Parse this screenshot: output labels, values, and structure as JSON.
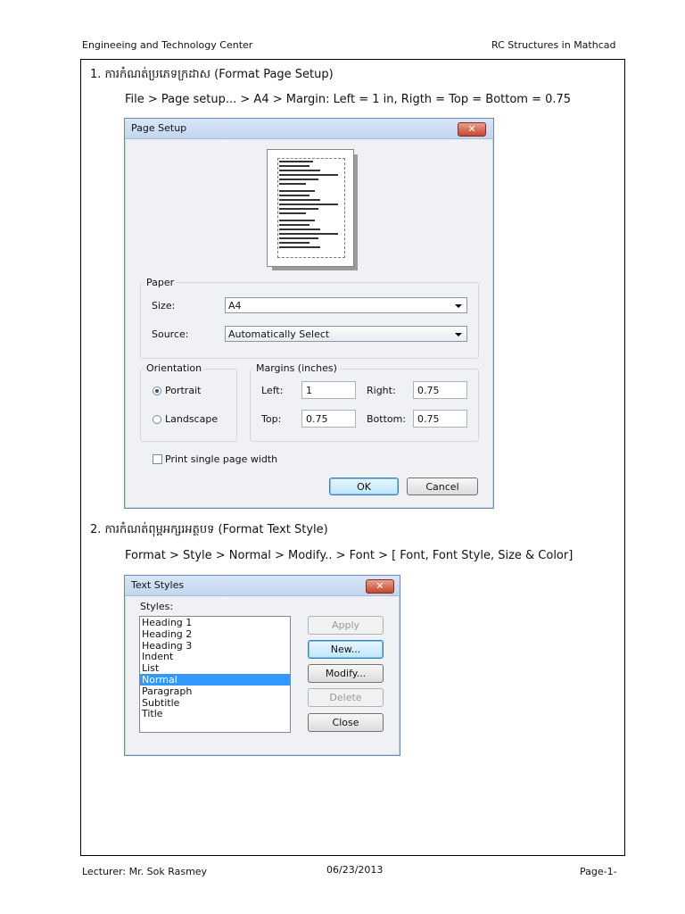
{
  "header": {
    "left": "Engineeing and Technology Center",
    "right": "RC Structures in Mathcad"
  },
  "section1": {
    "heading": "1. ការកំណត់ប្រភេទក្រដាស (Format Page Setup)",
    "path": "File > Page setup... > A4 > Margin: Left = 1 in,  Rigth = Top = Bottom = 0.75"
  },
  "page_setup": {
    "title": "Page Setup",
    "close": "✕",
    "paper_group": "Paper",
    "size_label": "Size:",
    "size_value": "A4",
    "source_label": "Source:",
    "source_value": "Automatically Select",
    "orientation_group": "Orientation",
    "portrait": "Portrait",
    "landscape": "Landscape",
    "margins_group": "Margins (inches)",
    "left_label": "Left:",
    "left_value": "1",
    "right_label": "Right:",
    "right_value": "0.75",
    "top_label": "Top:",
    "top_value": "0.75",
    "bottom_label": "Bottom:",
    "bottom_value": "0.75",
    "print_single": "Print single page width",
    "ok": "OK",
    "cancel": "Cancel"
  },
  "section2": {
    "heading": "2. ការកំណត់ពុម្ពអក្សរអត្ថបទ (Format Text Style)",
    "path": "Format > Style > Normal > Modify.. > Font > [ Font, Font Style, Size & Color]"
  },
  "text_styles": {
    "title": "Text Styles",
    "close": "✕",
    "styles_label": "Styles:",
    "items": [
      "Heading 1",
      "Heading 2",
      "Heading 3",
      "Indent",
      "List",
      "Normal",
      "Paragraph",
      "Subtitle",
      "Title"
    ],
    "apply": "Apply",
    "new": "New...",
    "modify": "Modify...",
    "delete": "Delete",
    "close_btn": "Close"
  },
  "footer": {
    "lecturer": "Lecturer: Mr. Sok Rasmey",
    "date": "06/23/2013",
    "page": "Page-1-"
  }
}
